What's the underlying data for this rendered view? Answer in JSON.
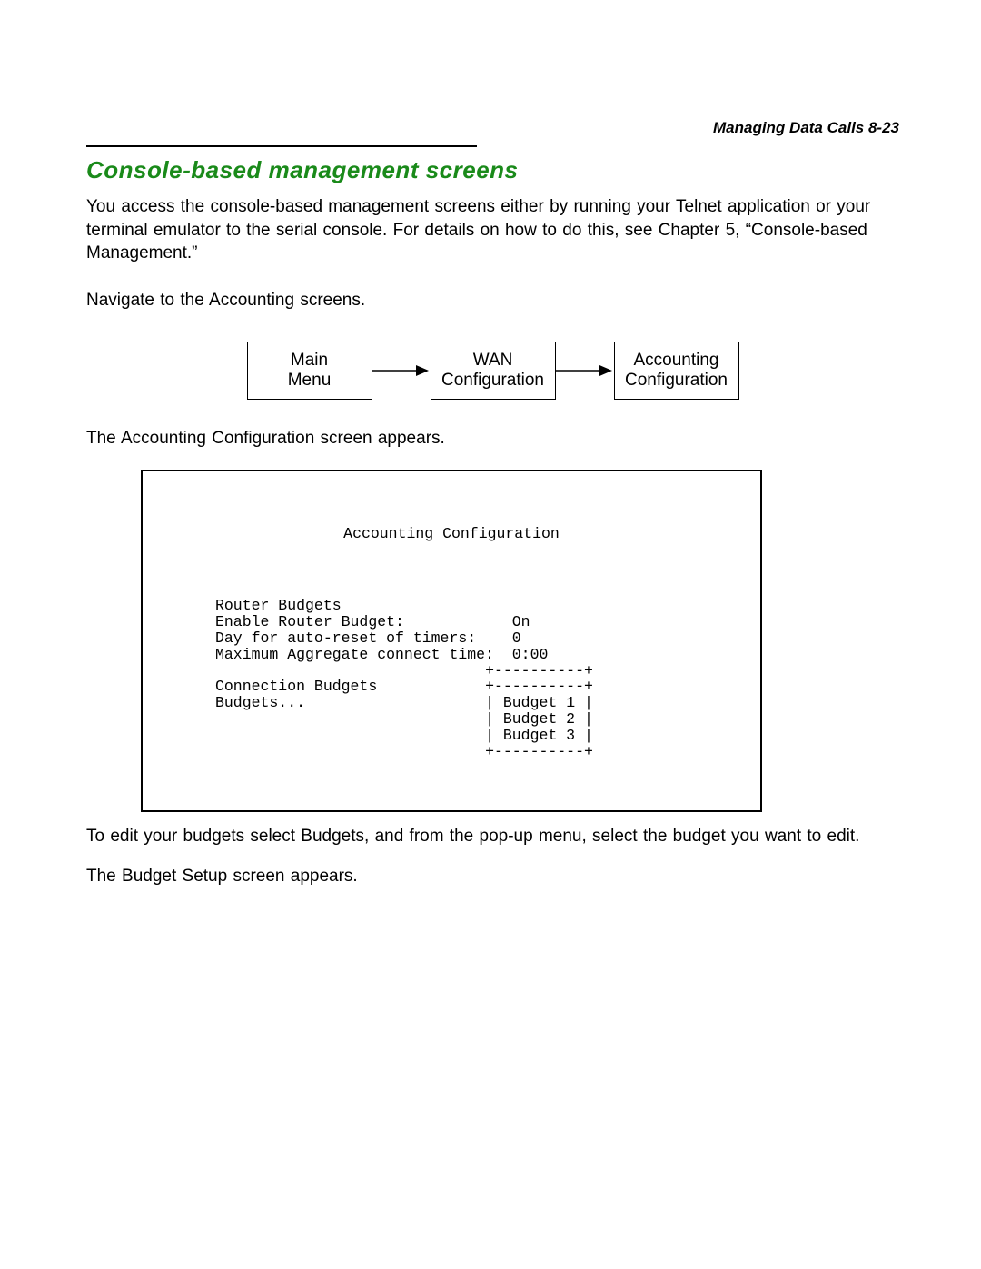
{
  "header": {
    "running_head": "Managing Data Calls  8-23"
  },
  "section": {
    "title": "Console-based management screens",
    "intro": "You access the console-based management screens either by running your Telnet application or your terminal emulator to the serial console. For details on how to do this, see Chapter 5, “Console-based Management.”",
    "nav_instruction": "Navigate to the Accounting screens."
  },
  "flow": {
    "box1_line1": "Main",
    "box1_line2": "Menu",
    "box2_line1": "WAN",
    "box2_line2": "Configuration",
    "box3_line1": "Accounting",
    "box3_line2": "Configuration"
  },
  "after_flow": "The Accounting Configuration screen appears.",
  "console": {
    "title": "Accounting Configuration",
    "lines": {
      "l1": "Router Budgets",
      "l2_label": "Enable Router Budget:",
      "l2_value": "On",
      "l3_label": "Day for auto-reset of timers:",
      "l3_value": "0",
      "l4_label": "Maximum Aggregate connect time:",
      "l4_value": "0:00",
      "sep_top": "+----------+",
      "l5_a": "Connection Budgets",
      "l5_b": "+----------+",
      "l6_a": "Budgets...",
      "l6_b": "| Budget 1 |",
      "l7_b": "| Budget 2 |",
      "l8_b": "| Budget 3 |",
      "sep_bot": "+----------+"
    }
  },
  "after_console_1": "To edit your budgets select Budgets, and from the pop-up menu, select the budget you want to edit.",
  "after_console_2": "The Budget Setup screen appears."
}
